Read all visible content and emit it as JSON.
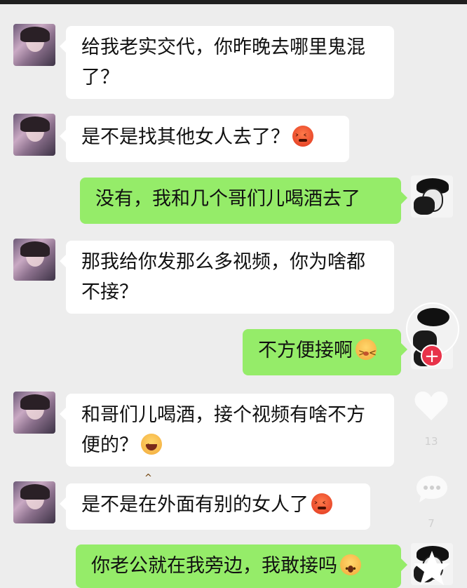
{
  "chat": {
    "messages": [
      {
        "side": "left",
        "text": "给我老实交代，你昨晚去哪里鬼混了？",
        "emoji": ""
      },
      {
        "side": "left",
        "text": "是不是找其他女人去了？",
        "emoji": "angry-face"
      },
      {
        "side": "right",
        "text": "没有，我和几个哥们儿喝酒去了",
        "emoji": ""
      },
      {
        "side": "left",
        "text": "那我给你发那么多视频，你为啥都不接？",
        "emoji": ""
      },
      {
        "side": "right",
        "text": "不方便接啊",
        "emoji": "shy-face"
      },
      {
        "side": "left",
        "text": "和哥们儿喝酒，接个视频有啥不方便的？",
        "emoji": "laughing-face"
      },
      {
        "side": "left",
        "text": "是不是在外面有别的女人了",
        "emoji": "angry-face"
      },
      {
        "side": "right",
        "text": "你老公就在我旁边，我敢接吗",
        "emoji": "shocked-face"
      }
    ]
  },
  "overlay": {
    "follow_icon": "plus",
    "like_count": "13",
    "comment_count": "7"
  },
  "colors": {
    "background": "#ededed",
    "bubble_left": "#ffffff",
    "bubble_right": "#95ec69",
    "follow_button": "#e8334a"
  }
}
